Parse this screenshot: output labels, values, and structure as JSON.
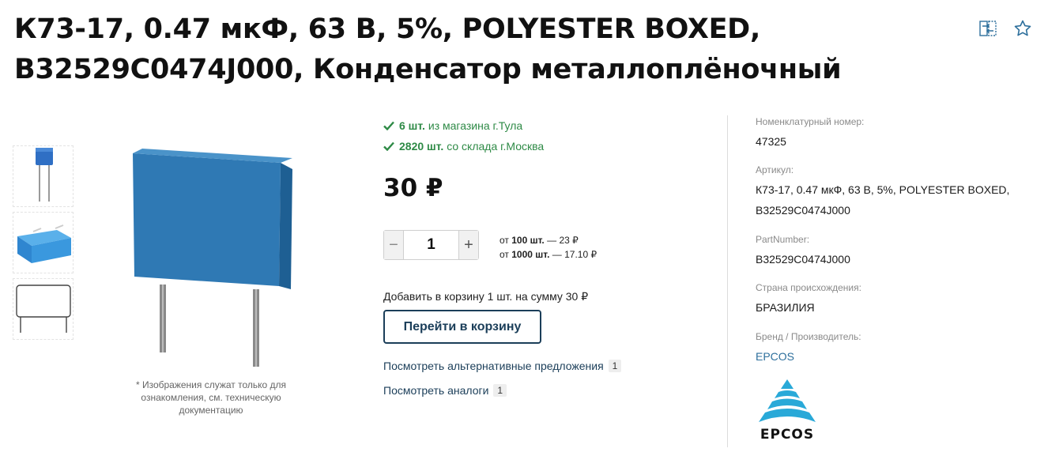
{
  "product": {
    "title": "К73-17, 0.47 мкФ, 63 В, 5%, POLYESTER BOXED, B32529C0474J000, Конденсатор металлоплёночный",
    "image_note": "* Изображения служат только для ознакомления, см. техническую документацию"
  },
  "title_icons": [
    "compare-icon",
    "favorite-star-icon"
  ],
  "thumbnails": [
    "photo-capacitor-side",
    "photo-capacitor-top",
    "drawing-capacitor-outline"
  ],
  "stock": [
    {
      "qty": "6 шт.",
      "text": "из магазина г.Тула"
    },
    {
      "qty": "2820 шт.",
      "text": "со склада г.Москва"
    }
  ],
  "price": "30 ₽",
  "quantity": {
    "value": "1",
    "minus": "−",
    "plus": "+"
  },
  "tiers": [
    {
      "prefix": "от",
      "qty": "100 шт.",
      "price": "— 23 ₽"
    },
    {
      "prefix": "от",
      "qty": "1000 шт.",
      "price": "— 17.10 ₽"
    }
  ],
  "cart": {
    "summary": "Добавить в корзину 1 шт. на сумму 30 ₽",
    "button": "Перейти в корзину"
  },
  "links": [
    {
      "label": "Посмотреть альтернативные предложения",
      "count": "1"
    },
    {
      "label": "Посмотреть аналоги",
      "count": "1"
    }
  ],
  "specs": {
    "nomenclature": {
      "label": "Номенклатурный номер:",
      "value": "47325"
    },
    "article": {
      "label": "Артикул:",
      "value": "К73-17, 0.47 мкФ, 63 В, 5%, POLYESTER BOXED, B32529C0474J000"
    },
    "part_number": {
      "label": "PartNumber:",
      "value": "B32529C0474J000"
    },
    "country": {
      "label": "Страна происхождения:",
      "value": "БРАЗИЛИЯ"
    },
    "brand": {
      "label": "Бренд / Производитель:",
      "value": "EPCOS"
    }
  },
  "brand_logo": {
    "text": "EPCOS",
    "color": "#29a9d8"
  },
  "colors": {
    "in_stock": "#2e8a46",
    "primary_dark": "#1b3e59",
    "link_blue": "#2d6f9c",
    "capacitor_blue": "#2f79b4"
  }
}
